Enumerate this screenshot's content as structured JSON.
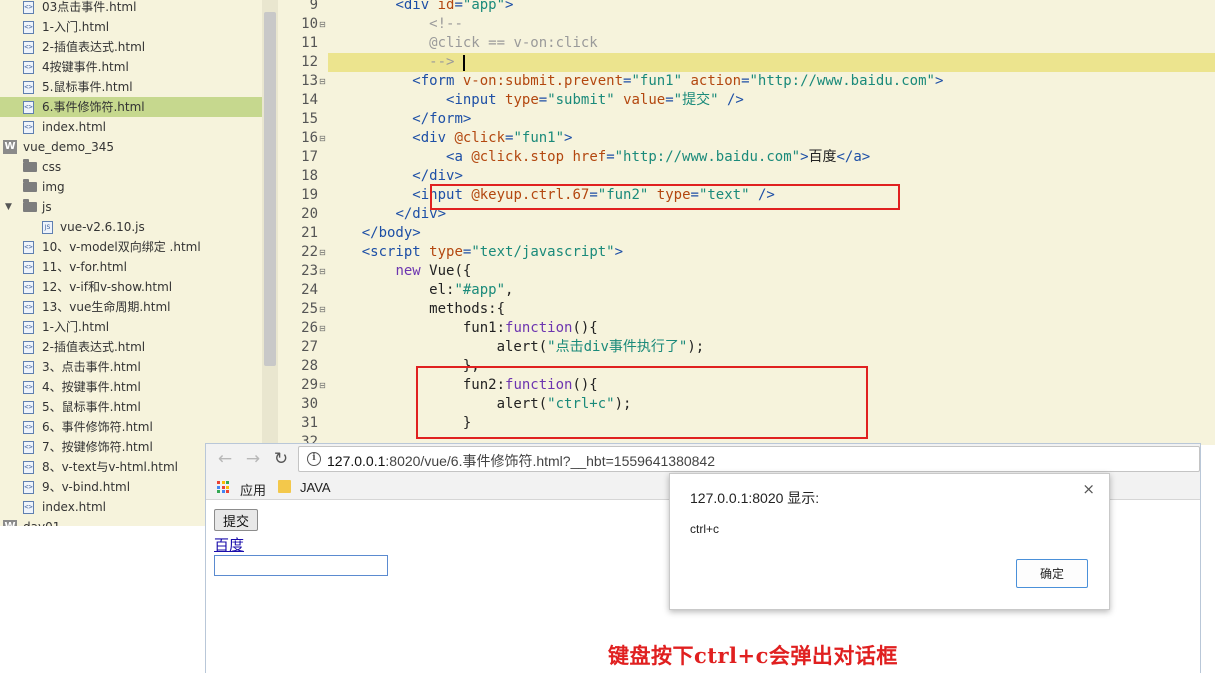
{
  "tree": {
    "items": [
      {
        "label": "03点击事件.html",
        "kind": "file"
      },
      {
        "label": "1-入门.html",
        "kind": "file"
      },
      {
        "label": "2-插值表达式.html",
        "kind": "file"
      },
      {
        "label": "4按键事件.html",
        "kind": "file"
      },
      {
        "label": "5.鼠标事件.html",
        "kind": "file"
      },
      {
        "label": "6.事件修饰符.html",
        "kind": "file",
        "selected": true
      },
      {
        "label": "index.html",
        "kind": "file"
      },
      {
        "label": "vue_demo_345",
        "kind": "project"
      },
      {
        "label": "css",
        "kind": "folder"
      },
      {
        "label": "img",
        "kind": "folder"
      },
      {
        "label": "js",
        "kind": "folder-open"
      },
      {
        "label": "vue-v2.6.10.js",
        "kind": "jsfile"
      },
      {
        "label": "10、v-model双向绑定 .html",
        "kind": "file"
      },
      {
        "label": "11、v-for.html",
        "kind": "file"
      },
      {
        "label": "12、v-if和v-show.html",
        "kind": "file"
      },
      {
        "label": "13、vue生命周期.html",
        "kind": "file"
      },
      {
        "label": "1-入门.html",
        "kind": "file"
      },
      {
        "label": "2-插值表达式.html",
        "kind": "file"
      },
      {
        "label": "3、点击事件.html",
        "kind": "file"
      },
      {
        "label": "4、按键事件.html",
        "kind": "file"
      },
      {
        "label": "5、鼠标事件.html",
        "kind": "file"
      },
      {
        "label": "6、事件修饰符.html",
        "kind": "file"
      },
      {
        "label": "7、按键修饰符.html",
        "kind": "file"
      },
      {
        "label": "8、v-text与v-html.html",
        "kind": "file"
      },
      {
        "label": "9、v-bind.html",
        "kind": "file"
      },
      {
        "label": "index.html",
        "kind": "file"
      },
      {
        "label": "day01",
        "kind": "project"
      }
    ],
    "icon_file": "file-icon",
    "icon_folder": "folder-icon"
  },
  "editor": {
    "line_numbers": [
      "9",
      "10",
      "11",
      "12",
      "13",
      "14",
      "15",
      "16",
      "17",
      "18",
      "19",
      "20",
      "21",
      "22",
      "23",
      "24",
      "25",
      "26",
      "27",
      "28",
      "29",
      "30",
      "31",
      "32"
    ],
    "code_lines": [
      [
        [
          "t-pl",
          "        "
        ],
        [
          "t-tag",
          "<div "
        ],
        [
          "t-attr",
          "id"
        ],
        [
          "t-tag",
          "="
        ],
        [
          "t-str",
          "\"app\""
        ],
        [
          "t-tag",
          ">"
        ]
      ],
      [
        [
          "t-pl",
          "            "
        ],
        [
          "t-com",
          "<!--"
        ]
      ],
      [
        [
          "t-pl",
          "            "
        ],
        [
          "t-com",
          "@click == v-on:click"
        ]
      ],
      [
        [
          "t-pl",
          "            "
        ],
        [
          "t-com",
          "-->"
        ]
      ],
      [
        [
          "t-pl",
          "          "
        ],
        [
          "t-tag",
          "<form "
        ],
        [
          "t-attr",
          "v-on:submit.prevent"
        ],
        [
          "t-tag",
          "="
        ],
        [
          "t-str",
          "\"fun1\""
        ],
        [
          "t-pl",
          " "
        ],
        [
          "t-attr",
          "action"
        ],
        [
          "t-tag",
          "="
        ],
        [
          "t-str",
          "\"http://www.baidu.com\""
        ],
        [
          "t-tag",
          ">"
        ]
      ],
      [
        [
          "t-pl",
          "              "
        ],
        [
          "t-tag",
          "<input "
        ],
        [
          "t-attr",
          "type"
        ],
        [
          "t-tag",
          "="
        ],
        [
          "t-str",
          "\"submit\""
        ],
        [
          "t-pl",
          " "
        ],
        [
          "t-attr",
          "value"
        ],
        [
          "t-tag",
          "="
        ],
        [
          "t-str",
          "\"提交\""
        ],
        [
          "t-tag",
          " />"
        ]
      ],
      [
        [
          "t-pl",
          "          "
        ],
        [
          "t-tag",
          "</form>"
        ]
      ],
      [
        [
          "t-pl",
          "          "
        ],
        [
          "t-tag",
          "<div "
        ],
        [
          "t-attr",
          "@click"
        ],
        [
          "t-tag",
          "="
        ],
        [
          "t-str",
          "\"fun1\""
        ],
        [
          "t-tag",
          ">"
        ]
      ],
      [
        [
          "t-pl",
          "              "
        ],
        [
          "t-tag",
          "<a "
        ],
        [
          "t-attr",
          "@click.stop"
        ],
        [
          "t-pl",
          " "
        ],
        [
          "t-attr",
          "href"
        ],
        [
          "t-tag",
          "="
        ],
        [
          "t-str",
          "\"http://www.baidu.com\""
        ],
        [
          "t-tag",
          ">"
        ],
        [
          "t-txt",
          "百度"
        ],
        [
          "t-tag",
          "</a>"
        ]
      ],
      [
        [
          "t-pl",
          "          "
        ],
        [
          "t-tag",
          "</div>"
        ]
      ],
      [
        [
          "t-pl",
          "          "
        ],
        [
          "t-tag",
          "<input "
        ],
        [
          "t-attr",
          "@keyup.ctrl.67"
        ],
        [
          "t-tag",
          "="
        ],
        [
          "t-str",
          "\"fun2\""
        ],
        [
          "t-pl",
          " "
        ],
        [
          "t-attr",
          "type"
        ],
        [
          "t-tag",
          "="
        ],
        [
          "t-str",
          "\"text\""
        ],
        [
          "t-tag",
          " />"
        ]
      ],
      [
        [
          "t-pl",
          "        "
        ],
        [
          "t-tag",
          "</div>"
        ]
      ],
      [
        [
          "t-pl",
          "    "
        ],
        [
          "t-tag",
          "</body>"
        ]
      ],
      [
        [
          "t-pl",
          "    "
        ],
        [
          "t-tag",
          "<script "
        ],
        [
          "t-attr",
          "type"
        ],
        [
          "t-tag",
          "="
        ],
        [
          "t-str",
          "\"text/javascript\""
        ],
        [
          "t-tag",
          ">"
        ]
      ],
      [
        [
          "t-pl",
          "        "
        ],
        [
          "t-kw",
          "new"
        ],
        [
          "t-pl",
          " Vue({"
        ]
      ],
      [
        [
          "t-pl",
          "            el:"
        ],
        [
          "t-str",
          "\"#app\""
        ],
        [
          "t-pl",
          ","
        ]
      ],
      [
        [
          "t-pl",
          "            methods:{"
        ]
      ],
      [
        [
          "t-pl",
          "                fun1:"
        ],
        [
          "t-kw",
          "function"
        ],
        [
          "t-pl",
          "(){"
        ]
      ],
      [
        [
          "t-pl",
          "                    alert("
        ],
        [
          "t-str",
          "\"点击div事件执行了\""
        ],
        [
          "t-pl",
          ");"
        ]
      ],
      [
        [
          "t-pl",
          "                },"
        ]
      ],
      [
        [
          "t-pl",
          "                fun2:"
        ],
        [
          "t-kw",
          "function"
        ],
        [
          "t-pl",
          "(){"
        ]
      ],
      [
        [
          "t-pl",
          "                    alert("
        ],
        [
          "t-str",
          "\"ctrl+c\""
        ],
        [
          "t-pl",
          ");"
        ]
      ],
      [
        [
          "t-pl",
          "                }"
        ]
      ],
      [
        [
          "t-pl",
          ""
        ]
      ]
    ]
  },
  "browser": {
    "back": "←",
    "forward": "→",
    "reload": "↻",
    "info": "i",
    "url_host": "127.0.0.1",
    "url_rest": ":8020/vue/6.事件修饰符.html?__hbt=1559641380842",
    "bookmark_apps": "应用",
    "bookmark_java": "JAVA",
    "submit_label": "提交",
    "link_label": "百度",
    "input_value": ""
  },
  "dialog": {
    "title": "127.0.0.1:8020 显示:",
    "close": "×",
    "message": "ctrl+c",
    "ok_label": "确定"
  },
  "caption": "键盘按下ctrl+c会弹出对话框",
  "colors": {
    "annotation_red": "#e02020",
    "selected_row": "#c6d88e",
    "editor_bg": "#f6f3dc",
    "current_line": "#ece48e"
  }
}
